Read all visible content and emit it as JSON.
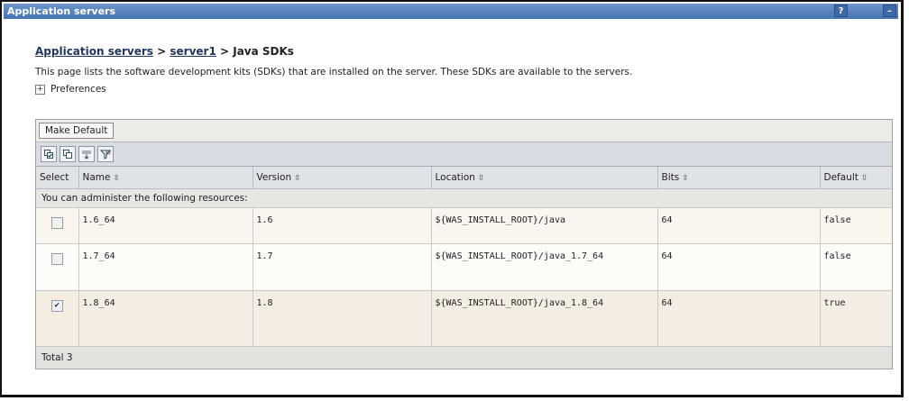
{
  "window": {
    "title": "Application servers",
    "help_label": "?",
    "minimize_label": "–"
  },
  "breadcrumb": {
    "root": "Application servers",
    "sep1": " > ",
    "server": "server1",
    "sep2": " > ",
    "current": "Java SDKs"
  },
  "description": "This page lists the software development kits (SDKs) that are installed on the server. These SDKs are available to the servers.",
  "preferences": {
    "expander": "+",
    "label": "Preferences"
  },
  "toolbar": {
    "make_default_label": "Make Default"
  },
  "icon_toolbar": [
    "select-all-icon",
    "deselect-all-icon",
    "show-filter-icon",
    "clear-filter-icon"
  ],
  "table": {
    "columns": [
      "Select",
      "Name",
      "Version",
      "Location",
      "Bits",
      "Default"
    ],
    "sort_glyph": "⇳",
    "resources_note": "You can administer the following resources:",
    "rows": [
      {
        "selected": false,
        "name": "1.6_64",
        "version": "1.6",
        "location": "${WAS_INSTALL_ROOT}/java",
        "bits": "64",
        "default": "false"
      },
      {
        "selected": false,
        "name": "1.7_64",
        "version": "1.7",
        "location": "${WAS_INSTALL_ROOT}/java_1.7_64",
        "bits": "64",
        "default": "false"
      },
      {
        "selected": true,
        "name": "1.8_64",
        "version": "1.8",
        "location": "${WAS_INSTALL_ROOT}/java_1.8_64",
        "bits": "64",
        "default": "true"
      }
    ],
    "total": "Total 3",
    "check_glyph": "✔"
  },
  "colors": {
    "title_bar": "#4f7fbf",
    "header_bg": "#dfe3e8",
    "row_bg": "#faf5ee"
  }
}
